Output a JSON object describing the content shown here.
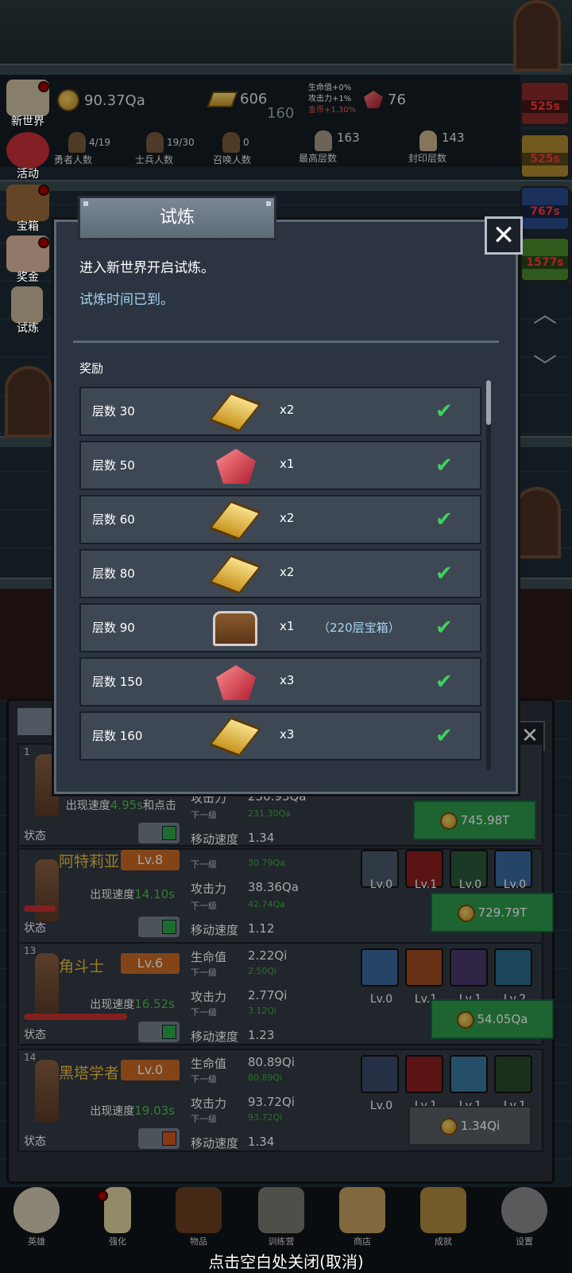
{
  "resources": {
    "coins": "90.37Qa",
    "gold_bars": "606",
    "level_number": "160",
    "rubies": "76"
  },
  "bonuses": {
    "hp": "生命值+0%",
    "atk": "攻击力+1%",
    "gold": "金币+1.30%"
  },
  "counters": [
    {
      "value": "4/19",
      "label": "勇者人数"
    },
    {
      "value": "19/30",
      "label": "士兵人数"
    },
    {
      "value": "0",
      "label": "召唤人数"
    },
    {
      "value": "163",
      "label": "最高层数"
    },
    {
      "value": "143",
      "label": "封印层数"
    }
  ],
  "left_menu": [
    "新世界",
    "活动",
    "宝箱",
    "奖金",
    "试炼"
  ],
  "right_timers": [
    "525s",
    "525s",
    "767s",
    "1577s"
  ],
  "modal": {
    "title": "试炼",
    "close": "✕",
    "line1": "进入新世界开启试炼。",
    "line2": "试炼时间已到。",
    "reward_label": "奖励",
    "rewards": [
      {
        "floor": "层数 30",
        "item": "gold",
        "count": "x2",
        "note": ""
      },
      {
        "floor": "层数 50",
        "item": "ruby",
        "count": "x1",
        "note": ""
      },
      {
        "floor": "层数 60",
        "item": "gold",
        "count": "x2",
        "note": ""
      },
      {
        "floor": "层数 80",
        "item": "gold",
        "count": "x2",
        "note": ""
      },
      {
        "floor": "层数 90",
        "item": "chest",
        "count": "x1",
        "note": "（220层宝箱）"
      },
      {
        "floor": "层数 150",
        "item": "ruby",
        "count": "x3",
        "note": ""
      },
      {
        "floor": "层数 160",
        "item": "gold",
        "count": "x3",
        "note": ""
      }
    ],
    "check": "✔"
  },
  "heroes": [
    {
      "num": "1",
      "name": "",
      "lv": "",
      "speed_label": "出现速度",
      "speed": "4.95s",
      "speed_suffix": "和点击",
      "hp": "",
      "hp_next": "",
      "atk": "230.93Qa",
      "atk_next": "231.30Qa",
      "move": "1.34",
      "cost": "745.98T",
      "active": true
    },
    {
      "num": "",
      "name": "阿特莉亚",
      "lv": "Lv.8",
      "speed_label": "出现速度",
      "speed": "14.10s",
      "speed_suffix": "",
      "hp": "",
      "hp_next": "30.79Qa",
      "atk": "38.36Qa",
      "atk_next": "42.74Qa",
      "move": "1.12",
      "cost": "729.79T",
      "active": true,
      "skills": [
        "Lv.0",
        "Lv.1",
        "Lv.0",
        "Lv.0"
      ]
    },
    {
      "num": "13",
      "name": "角斗士",
      "lv": "Lv.6",
      "speed_label": "出现速度",
      "speed": "16.52s",
      "speed_suffix": "",
      "hp": "2.22Qi",
      "hp_next": "2.50Qi",
      "atk": "2.77Qi",
      "atk_next": "3.12Qi",
      "move": "1.23",
      "cost": "54.05Qa",
      "active": true,
      "skills": [
        "Lv.0",
        "Lv.1",
        "Lv.1",
        "Lv.2"
      ]
    },
    {
      "num": "14",
      "name": "黑塔学者",
      "lv": "Lv.0",
      "speed_label": "出现速度",
      "speed": "19.03s",
      "speed_suffix": "",
      "hp": "80.89Qi",
      "hp_next": "80.89Qi",
      "atk": "93.72Qi",
      "atk_next": "93.72Qi",
      "move": "1.34",
      "cost": "1.34Qi",
      "active": false,
      "skills": [
        "Lv.0",
        "Lv.1",
        "Lv.1",
        "Lv.1"
      ]
    }
  ],
  "labels": {
    "hp": "生命值",
    "atk": "攻击力",
    "next": "下一级",
    "move": "移动速度",
    "state": "状态"
  },
  "bottom_nav": [
    "英雄",
    "强化",
    "物品",
    "训练营",
    "商店",
    "成就",
    "设置"
  ],
  "close_hint": "点击空白处关闭(取消)",
  "colors": {
    "accent_green": "#2e9a4a",
    "level_orange": "#c96a24",
    "check_green": "#3fd060"
  }
}
